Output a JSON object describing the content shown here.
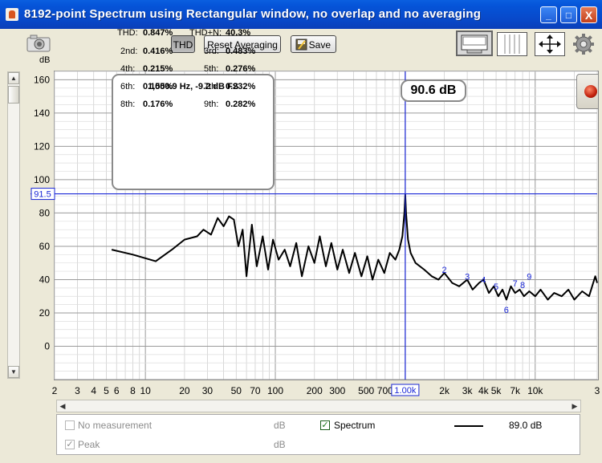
{
  "window": {
    "title": "8192-point Spectrum using Rectangular window, no overlap and no averaging",
    "controls": [
      "_",
      "□",
      "X"
    ]
  },
  "toolbar": {
    "thd_label": "THD",
    "reset_label": "Reset Averaging",
    "save_label": "Save",
    "icons": [
      "camera-icon",
      "save-icon",
      "view-spectrum-icon",
      "view-grid-icon",
      "move-icon",
      "gear-icon"
    ]
  },
  "thd_panel": {
    "header": "1,000.9 Hz, -9.2 dB FS",
    "rows": [
      {
        "l1": "THD:",
        "v1": "0.847%",
        "l2": "THD+N:",
        "v2": "40.3%"
      },
      {
        "l1": "2nd:",
        "v1": "0.416%",
        "l2": "3rd:",
        "v2": "0.483%"
      },
      {
        "l1": "4th:",
        "v1": "0.215%",
        "l2": "5th:",
        "v2": "0.276%"
      },
      {
        "l1": "6th:",
        "v1": "0.155%",
        "l2": "7th:",
        "v2": "0.232%"
      },
      {
        "l1": "8th:",
        "v1": "0.176%",
        "l2": "9th:",
        "v2": "0.282%"
      }
    ]
  },
  "cursor": {
    "readout": "90.6 dB",
    "y_label": "91.5",
    "x_label": "1.00k",
    "x_hz": 1000,
    "y_db": 91.5
  },
  "chart_data": {
    "type": "line",
    "ylabel": "dB",
    "ylim": [
      -20,
      165
    ],
    "xlim": [
      2,
      30000
    ],
    "x_scale": "log",
    "y_ticks": [
      0,
      20,
      40,
      60,
      80,
      100,
      120,
      140,
      160
    ],
    "x_ticks": [
      {
        "v": 2,
        "t": "2"
      },
      {
        "v": 3,
        "t": "3"
      },
      {
        "v": 4,
        "t": "4"
      },
      {
        "v": 5,
        "t": "5"
      },
      {
        "v": 6,
        "t": "6"
      },
      {
        "v": 8,
        "t": "8"
      },
      {
        "v": 10,
        "t": "10"
      },
      {
        "v": 20,
        "t": "20"
      },
      {
        "v": 30,
        "t": "30"
      },
      {
        "v": 50,
        "t": "50"
      },
      {
        "v": 70,
        "t": "70"
      },
      {
        "v": 100,
        "t": "100"
      },
      {
        "v": 200,
        "t": "200"
      },
      {
        "v": 300,
        "t": "300"
      },
      {
        "v": 500,
        "t": "500"
      },
      {
        "v": 700,
        "t": "700"
      },
      {
        "v": 2000,
        "t": "2k"
      },
      {
        "v": 3000,
        "t": "3k"
      },
      {
        "v": 4000,
        "t": "4k"
      },
      {
        "v": 5000,
        "t": "5k"
      },
      {
        "v": 7000,
        "t": "7k"
      },
      {
        "v": 10000,
        "t": "10k"
      },
      {
        "v": 30000,
        "t": "3"
      }
    ],
    "grid": true,
    "series": [
      {
        "name": "Spectrum",
        "color": "#000000",
        "points": [
          [
            5.5,
            58
          ],
          [
            8,
            55
          ],
          [
            12,
            51
          ],
          [
            16,
            58
          ],
          [
            20,
            64
          ],
          [
            25,
            66
          ],
          [
            28,
            70
          ],
          [
            32,
            67
          ],
          [
            36,
            77
          ],
          [
            40,
            72
          ],
          [
            44,
            78
          ],
          [
            48,
            76
          ],
          [
            52,
            60
          ],
          [
            56,
            70
          ],
          [
            60,
            42
          ],
          [
            66,
            73
          ],
          [
            72,
            48
          ],
          [
            80,
            66
          ],
          [
            88,
            46
          ],
          [
            96,
            64
          ],
          [
            106,
            52
          ],
          [
            118,
            58
          ],
          [
            130,
            48
          ],
          [
            145,
            62
          ],
          [
            160,
            42
          ],
          [
            180,
            60
          ],
          [
            200,
            50
          ],
          [
            220,
            66
          ],
          [
            245,
            48
          ],
          [
            270,
            62
          ],
          [
            300,
            46
          ],
          [
            330,
            58
          ],
          [
            370,
            44
          ],
          [
            410,
            56
          ],
          [
            460,
            42
          ],
          [
            510,
            54
          ],
          [
            560,
            40
          ],
          [
            620,
            52
          ],
          [
            690,
            44
          ],
          [
            760,
            56
          ],
          [
            840,
            52
          ],
          [
            900,
            58
          ],
          [
            950,
            66
          ],
          [
            985,
            80
          ],
          [
            1000,
            91
          ],
          [
            1015,
            80
          ],
          [
            1050,
            64
          ],
          [
            1100,
            56
          ],
          [
            1200,
            50
          ],
          [
            1400,
            46
          ],
          [
            1600,
            42
          ],
          [
            1800,
            40
          ],
          [
            2000,
            44
          ],
          [
            2300,
            38
          ],
          [
            2600,
            36
          ],
          [
            3000,
            40
          ],
          [
            3300,
            34
          ],
          [
            3700,
            38
          ],
          [
            4000,
            40
          ],
          [
            4400,
            32
          ],
          [
            4800,
            36
          ],
          [
            5200,
            30
          ],
          [
            5600,
            34
          ],
          [
            6000,
            28
          ],
          [
            6500,
            36
          ],
          [
            7000,
            32
          ],
          [
            7600,
            34
          ],
          [
            8200,
            30
          ],
          [
            9000,
            33
          ],
          [
            10000,
            30
          ],
          [
            11000,
            34
          ],
          [
            12500,
            28
          ],
          [
            14000,
            32
          ],
          [
            16000,
            30
          ],
          [
            18000,
            34
          ],
          [
            20000,
            28
          ],
          [
            23000,
            33
          ],
          [
            26000,
            30
          ],
          [
            29000,
            42
          ],
          [
            30000,
            38
          ]
        ]
      }
    ],
    "harmonic_markers": [
      {
        "label": "2",
        "x": 2000,
        "y": 44
      },
      {
        "label": "3",
        "x": 3000,
        "y": 40
      },
      {
        "label": "4",
        "x": 4000,
        "y": 38
      },
      {
        "label": "5",
        "x": 5000,
        "y": 34
      },
      {
        "label": "6",
        "x": 6000,
        "y": 20
      },
      {
        "label": "7",
        "x": 7000,
        "y": 36
      },
      {
        "label": "8",
        "x": 8000,
        "y": 35
      },
      {
        "label": "9",
        "x": 9000,
        "y": 40
      }
    ]
  },
  "legend": {
    "no_measurement_label": "No measurement",
    "no_measurement_unit": "dB",
    "peak_label": "Peak",
    "peak_unit": "dB",
    "spectrum_label": "Spectrum",
    "spectrum_value": "89.0 dB"
  },
  "colors": {
    "cursor": "#1a27d6",
    "accent": "#0a4fd6"
  }
}
